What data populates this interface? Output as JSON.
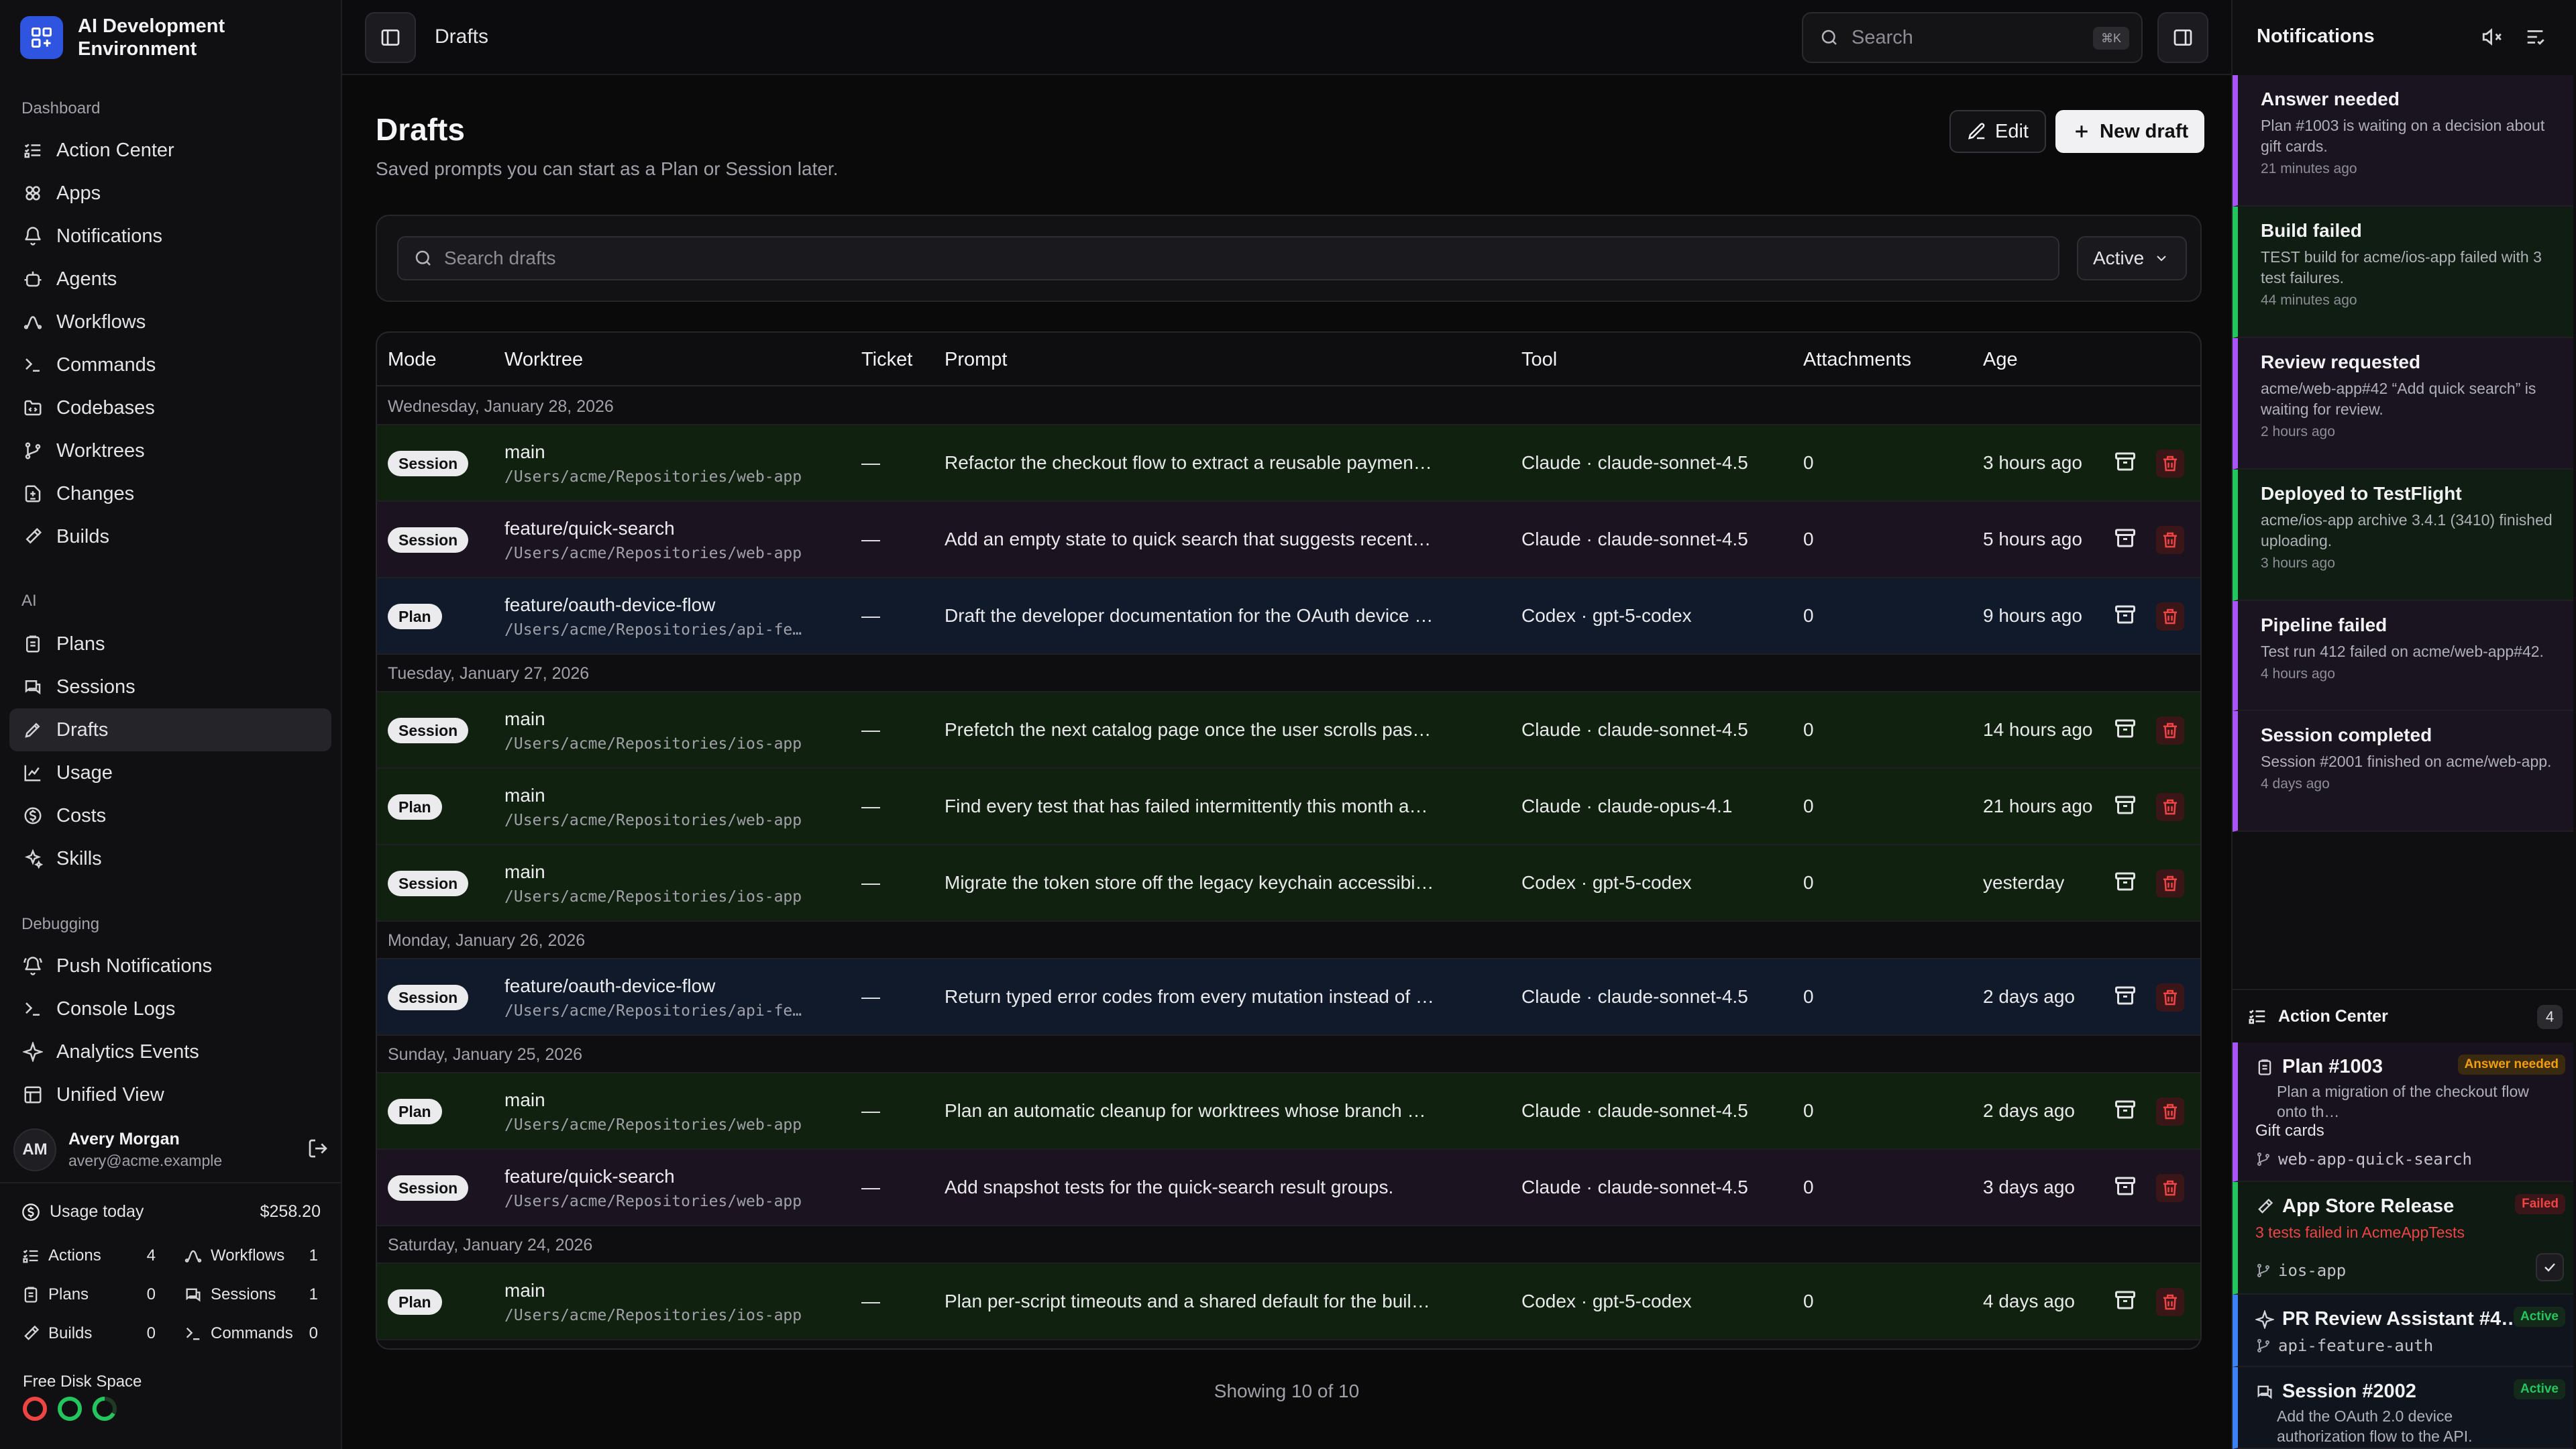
{
  "brand": {
    "name": "AI Development Environment"
  },
  "sidebar": {
    "sections": [
      {
        "label": "Dashboard",
        "items": [
          {
            "label": "Action Center",
            "icon": "list-checks-icon"
          },
          {
            "label": "Apps",
            "icon": "apps-icon"
          },
          {
            "label": "Notifications",
            "icon": "bell-icon"
          },
          {
            "label": "Agents",
            "icon": "bot-icon"
          },
          {
            "label": "Workflows",
            "icon": "workflow-icon"
          },
          {
            "label": "Commands",
            "icon": "terminal-icon"
          },
          {
            "label": "Codebases",
            "icon": "folder-code-icon"
          },
          {
            "label": "Worktrees",
            "icon": "git-branch-icon"
          },
          {
            "label": "Changes",
            "icon": "file-diff-icon"
          },
          {
            "label": "Builds",
            "icon": "hammer-icon"
          }
        ]
      },
      {
        "label": "AI",
        "items": [
          {
            "label": "Plans",
            "icon": "clipboard-icon"
          },
          {
            "label": "Sessions",
            "icon": "chat-icon"
          },
          {
            "label": "Drafts",
            "icon": "draft-icon",
            "active": true
          },
          {
            "label": "Usage",
            "icon": "chart-icon"
          },
          {
            "label": "Costs",
            "icon": "dollar-icon"
          },
          {
            "label": "Skills",
            "icon": "sparkles-icon"
          }
        ]
      },
      {
        "label": "Debugging",
        "items": [
          {
            "label": "Push Notifications",
            "icon": "bell-ring-icon"
          },
          {
            "label": "Console Logs",
            "icon": "terminal-icon"
          },
          {
            "label": "Analytics Events",
            "icon": "sparkle-icon"
          },
          {
            "label": "Unified View",
            "icon": "layout-icon"
          }
        ]
      }
    ],
    "user": {
      "initials": "AM",
      "name": "Avery Morgan",
      "email": "avery@acme.example"
    },
    "usage": {
      "label": "Usage today",
      "value": "$258.20",
      "stats": [
        {
          "label": "Actions",
          "value": "4"
        },
        {
          "label": "Workflows",
          "value": "1"
        },
        {
          "label": "Plans",
          "value": "0"
        },
        {
          "label": "Sessions",
          "value": "1"
        },
        {
          "label": "Builds",
          "value": "0"
        },
        {
          "label": "Commands",
          "value": "0"
        }
      ]
    },
    "disk": {
      "label": "Free Disk Space"
    }
  },
  "topbar": {
    "breadcrumb": "Drafts",
    "search_placeholder": "Search",
    "shortcut": "⌘K"
  },
  "page": {
    "title": "Drafts",
    "subtitle": "Saved prompts you can start as a Plan or Session later.",
    "edit_label": "Edit",
    "new_label": "New draft",
    "search_placeholder": "Search drafts",
    "filter_value": "Active",
    "showing": "Showing 10 of 10"
  },
  "table": {
    "columns": [
      "Mode",
      "Worktree",
      "Ticket",
      "Prompt",
      "Tool",
      "Attachments",
      "Age"
    ],
    "groups": [
      {
        "date": "Wednesday, January 28, 2026",
        "rows": [
          {
            "mode": "Session",
            "branch": "main",
            "path": "/Users/acme/Repositories/web-app",
            "ticket": "—",
            "prompt": "Refactor the checkout flow to extract a reusable paymen…",
            "tool": "Claude · claude-sonnet-4.5",
            "attachments": "0",
            "age": "3 hours ago",
            "tint": "green"
          },
          {
            "mode": "Session",
            "branch": "feature/quick-search",
            "path": "/Users/acme/Repositories/web-app",
            "ticket": "—",
            "prompt": "Add an empty state to quick search that suggests recent…",
            "tool": "Claude · claude-sonnet-4.5",
            "attachments": "0",
            "age": "5 hours ago",
            "tint": "purple"
          },
          {
            "mode": "Plan",
            "branch": "feature/oauth-device-flow",
            "path": "/Users/acme/Repositories/api-feature-auth",
            "ticket": "—",
            "prompt": "Draft the developer documentation for the OAuth device …",
            "tool": "Codex · gpt-5-codex",
            "attachments": "0",
            "age": "9 hours ago",
            "tint": "blue"
          }
        ]
      },
      {
        "date": "Tuesday, January 27, 2026",
        "rows": [
          {
            "mode": "Session",
            "branch": "main",
            "path": "/Users/acme/Repositories/ios-app",
            "ticket": "—",
            "prompt": "Prefetch the next catalog page once the user scrolls pas…",
            "tool": "Claude · claude-sonnet-4.5",
            "attachments": "0",
            "age": "14 hours ago",
            "tint": "green"
          },
          {
            "mode": "Plan",
            "branch": "main",
            "path": "/Users/acme/Repositories/web-app",
            "ticket": "—",
            "prompt": "Find every test that has failed intermittently this month a…",
            "tool": "Claude · claude-opus-4.1",
            "attachments": "0",
            "age": "21 hours ago",
            "tint": "green"
          },
          {
            "mode": "Session",
            "branch": "main",
            "path": "/Users/acme/Repositories/ios-app",
            "ticket": "—",
            "prompt": "Migrate the token store off the legacy keychain accessibi…",
            "tool": "Codex · gpt-5-codex",
            "attachments": "0",
            "age": "yesterday",
            "tint": "green"
          }
        ]
      },
      {
        "date": "Monday, January 26, 2026",
        "rows": [
          {
            "mode": "Session",
            "branch": "feature/oauth-device-flow",
            "path": "/Users/acme/Repositories/api-feature-auth",
            "ticket": "—",
            "prompt": "Return typed error codes from every mutation instead of …",
            "tool": "Claude · claude-sonnet-4.5",
            "attachments": "0",
            "age": "2 days ago",
            "tint": "blue"
          }
        ]
      },
      {
        "date": "Sunday, January 25, 2026",
        "rows": [
          {
            "mode": "Plan",
            "branch": "main",
            "path": "/Users/acme/Repositories/web-app",
            "ticket": "—",
            "prompt": "Plan an automatic cleanup for worktrees whose branch …",
            "tool": "Claude · claude-sonnet-4.5",
            "attachments": "0",
            "age": "2 days ago",
            "tint": "green"
          },
          {
            "mode": "Session",
            "branch": "feature/quick-search",
            "path": "/Users/acme/Repositories/web-app",
            "ticket": "—",
            "prompt": "Add snapshot tests for the quick-search result groups.",
            "tool": "Claude · claude-sonnet-4.5",
            "attachments": "0",
            "age": "3 days ago",
            "tint": "purple"
          }
        ]
      },
      {
        "date": "Saturday, January 24, 2026",
        "rows": [
          {
            "mode": "Plan",
            "branch": "main",
            "path": "/Users/acme/Repositories/ios-app",
            "ticket": "—",
            "prompt": "Plan per-script timeouts and a shared default for the buil…",
            "tool": "Codex · gpt-5-codex",
            "attachments": "0",
            "age": "4 days ago",
            "tint": "green"
          }
        ]
      }
    ]
  },
  "notifications": {
    "title": "Notifications",
    "items": [
      {
        "title": "Answer needed",
        "body": "Plan #1003 is waiting on a decision about gift cards.",
        "age": "21 minutes ago",
        "color": "#a855f7",
        "bg": "#1a1420"
      },
      {
        "title": "Build failed",
        "body": "TEST build for acme/ios-app failed with 3 test failures.",
        "age": "44 minutes ago",
        "color": "#22c55e",
        "bg": "#0f1d12"
      },
      {
        "title": "Review requested",
        "body": "acme/web-app#42 “Add quick search” is waiting for review.",
        "age": "2 hours ago",
        "color": "#a855f7",
        "bg": "#1a1420"
      },
      {
        "title": "Deployed to TestFlight",
        "body": "acme/ios-app archive 3.4.1 (3410) finished uploading.",
        "age": "3 hours ago",
        "color": "#22c55e",
        "bg": "#0f1d12"
      },
      {
        "title": "Pipeline failed",
        "body": "Test run 412 failed on acme/web-app#42.",
        "age": "4 hours ago",
        "color": "#a855f7",
        "bg": "#1a1420"
      },
      {
        "title": "Session completed",
        "body": "Session #2001 finished on acme/web-app.",
        "age": "4 days ago",
        "color": "#a855f7",
        "bg": "#1a1420"
      }
    ]
  },
  "action_center": {
    "title": "Action Center",
    "count": "4",
    "items": [
      {
        "title": "Plan #1003",
        "pill": "Answer needed",
        "desc": "Plan a migration of the checkout flow onto th…",
        "extra": "Gift cards",
        "branch": "web-app-quick-search",
        "color": "#a855f7"
      },
      {
        "title": "App Store Release",
        "pill": "Failed",
        "desc": "3 tests failed in AcmeAppTests",
        "branch": "ios-app",
        "color": "#22c55e"
      },
      {
        "title": "PR Review Assistant #4…",
        "pill": "Active",
        "branch": "api-feature-auth",
        "color": "#3b82f6"
      },
      {
        "title": "Session #2002",
        "pill": "Active",
        "desc": "Add the OAuth 2.0 device authorization flow to the API.",
        "color": "#3b82f6"
      }
    ]
  }
}
